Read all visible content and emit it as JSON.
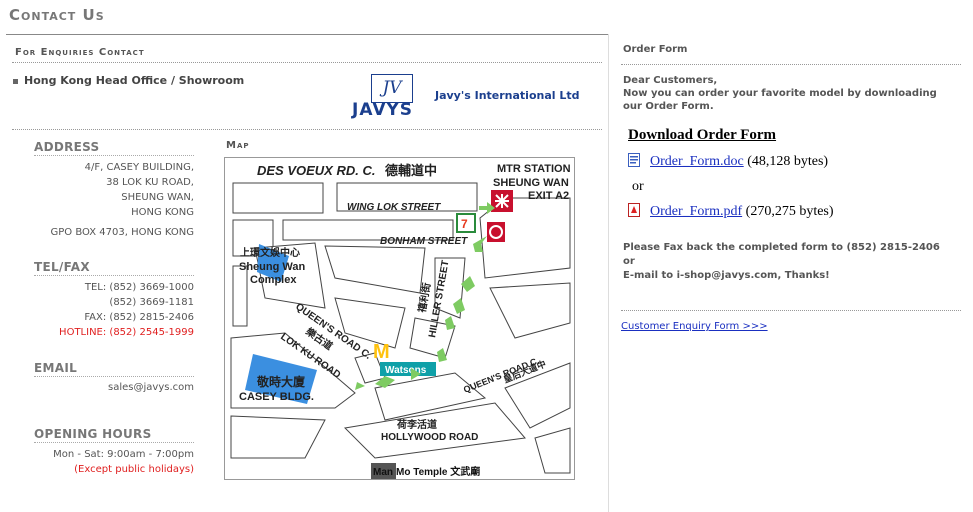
{
  "page": {
    "title": "Contact Us",
    "subtitle": "For Enquiries Contact",
    "office_heading": "Hong Kong Head Office / Showroom"
  },
  "logo": {
    "monogram": "JV",
    "wordmark": "JAVYS",
    "company_name": "Javy's International Ltd"
  },
  "address": {
    "heading": "ADDRESS",
    "lines": [
      "4/F, CASEY BUILDING,",
      "38 LOK KU ROAD,",
      "SHEUNG WAN,",
      "HONG KONG"
    ],
    "po_box": "GPO BOX 4703, HONG KONG"
  },
  "telfax": {
    "heading": "TEL/FAX",
    "lines": [
      "TEL: (852) 3669-1000",
      "(852) 3669-1181",
      "FAX: (852) 2815-2406"
    ],
    "hotline": "HOTLINE: (852) 2545-1999"
  },
  "email": {
    "heading": "EMAIL",
    "address": "sales@javys.com"
  },
  "hours": {
    "heading": "OPENING HOURS",
    "schedule": "Mon - Sat: 9:00am - 7:00pm",
    "note": "(Except public holidays)"
  },
  "map": {
    "label": "Map",
    "des_voeux": "DES VOEUX RD. C.",
    "des_voeux_cn": "德輔道中",
    "mtr_line1": "MTR STATION",
    "mtr_line2": "SHEUNG WAN",
    "mtr_line3": "EXIT A2",
    "wing_lok": "WING LOK STREET",
    "bonham": "BONHAM STREET",
    "sheung_wan_cn": "上環文娛中心",
    "sheung_wan_1": "Sheung Wan",
    "sheung_wan_2": "Complex",
    "hiller": "HILLER STREET",
    "hiller_cn": "禧利街",
    "queens": "QUEEN'S ROAD C.",
    "queens_cn": "皇后大道中",
    "queens2": "QUEEN'S ROAD C.",
    "queens2_cn": "皇后大道中",
    "lok_ku_cn": "樂古道",
    "lok_ku": "LOK KU ROAD",
    "casey_cn": "敬時大廈",
    "casey": "CASEY BLDG.",
    "watsons": "Watsons",
    "hollywood_cn": "荷李活道",
    "hollywood": "HOLLYWOOD ROAD",
    "temple_a": "Man",
    "temple_b": " Mo Temple 文武廟"
  },
  "order": {
    "title": "Order Form",
    "intro_1": "Dear Customers,",
    "intro_2": "Now you can order your favorite model by downloading",
    "intro_3": "our Order Form.",
    "download_title": "Download Order Form",
    "doc_link": "Order_Form.doc",
    "doc_size": " (48,128 bytes)",
    "or": "or",
    "pdf_link": "Order_Form.pdf",
    "pdf_size": " (270,275 bytes)",
    "fax_1": "Please Fax back the completed form to (852) 2815-2406 or",
    "fax_2": "E-mail to i-shop@javys.com, Thanks!",
    "enquiry_link": "Customer Enquiry Form  >>>"
  },
  "colors": {
    "link": "#1a2fc0",
    "hotline": "#e02020",
    "brand": "#1b3f8e"
  }
}
